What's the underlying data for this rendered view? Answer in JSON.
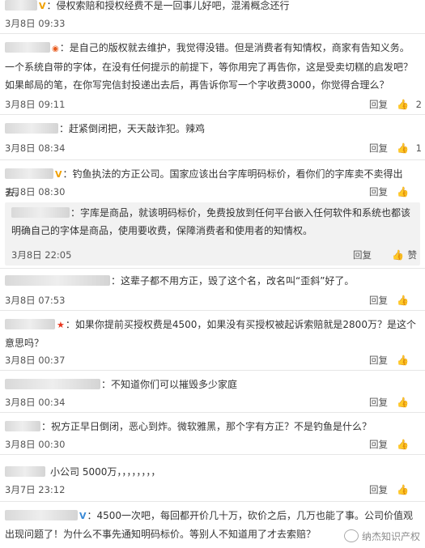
{
  "comments": [
    {
      "text": "：侵权索赔和授权经费不是一回事儿好吧，混淆概念还行",
      "time": "3月8日 09:33",
      "reply": "",
      "likes": ""
    },
    {
      "text": "：是自己的版权就去维护，我觉得没错。但是消费者有知情权，商家有告知义务。一个系统自带的字体，在没有任何提示的前提下，等你用完了再告你，这是受卖切糕的启发吧？如果邮局的笔，在你写完信封投递出去后，再告诉你写一个字收费3000，你觉得合理么？",
      "time": "3月8日 09:11",
      "reply": "回复",
      "likes": "2"
    },
    {
      "text": "：赶紧倒闭把，天天敲诈犯。辣鸡",
      "time": "3月8日 08:34",
      "reply": "回复",
      "likes": "1"
    },
    {
      "text": "：钓鱼执法的方正公司。国家应该出台字库明码标价，看你们的字库卖不卖得出去。",
      "time": "3月8日 08:30",
      "reply": "回复",
      "likes": ""
    },
    {
      "text": "：这辈子都不用方正，毁了这个名，改名叫“歪斜”好了。",
      "time": "3月8日 07:53",
      "reply": "回复",
      "likes": ""
    },
    {
      "text": "：如果你提前买授权费是4500，如果没有买授权被起诉索赔就是2800万？是这个意思吗？",
      "time": "3月8日 00:37",
      "reply": "回复",
      "likes": ""
    },
    {
      "text": "：不知道你们可以摧毁多少家庭",
      "time": "3月8日 00:34",
      "reply": "回复",
      "likes": ""
    },
    {
      "text": "：祝方正早日倒闭，恶心到炸。微软雅黑，那个字有方正？不是钓鱼是什么？",
      "time": "3月8日 00:30",
      "reply": "回复",
      "likes": ""
    },
    {
      "text": "小公司 5000万，，，，，，，，",
      "time": "3月7日 23:12",
      "reply": "回复",
      "likes": ""
    },
    {
      "text": "：4500一次吧，每回都开价几十万，砍价之后，几万也能了事。公司价值观出现问题了！为什么不事先通知明码标价。等别人不知道用了才去索赔？"
    }
  ],
  "subreply": {
    "text": "：字库是商品，就该明码标价，免费投放到任何平台嵌入任何软件和系统也都该明确自己的字体是商品，使用要收费，保障消费者和使用者的知情权。",
    "time": "3月8日 22:05",
    "reply": "回复",
    "like": "赞"
  },
  "watermark": "纳杰知识产权",
  "icons": {
    "like": "thumbs-up-icon",
    "verified": "verified-badge-icon",
    "star": "star-badge-icon"
  }
}
